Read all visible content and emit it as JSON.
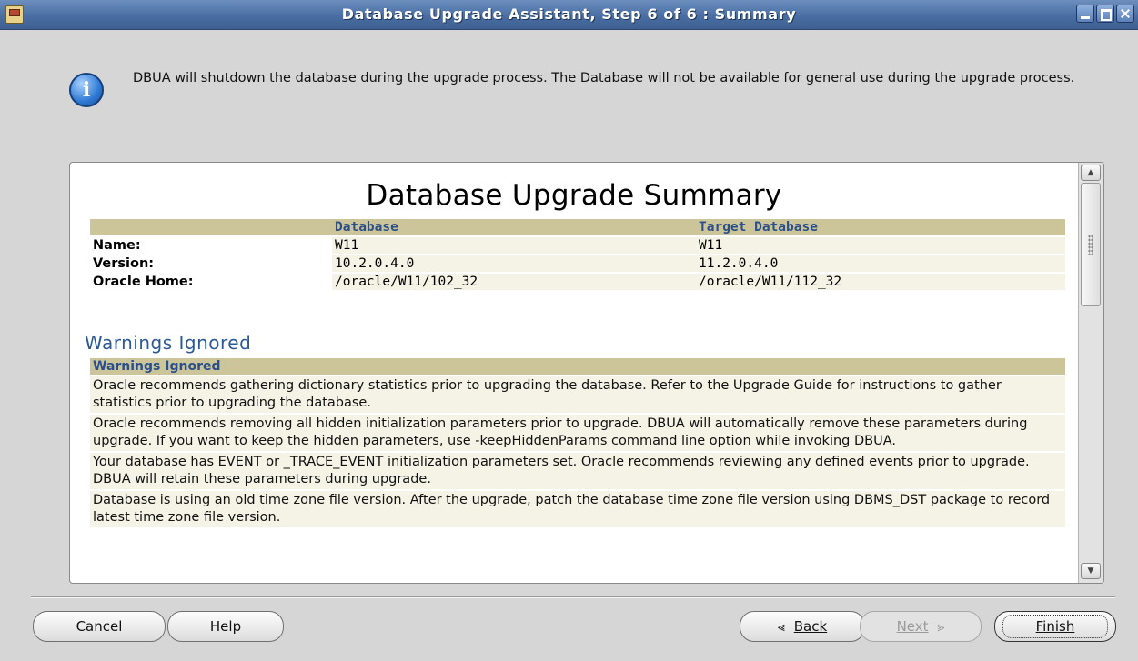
{
  "window": {
    "title": "Database Upgrade Assistant, Step 6 of 6 : Summary"
  },
  "info": {
    "icon": "info-icon",
    "message": "DBUA will shutdown the database during the upgrade process. The Database will not be available for general use during the upgrade process."
  },
  "summary": {
    "heading": "Database Upgrade Summary",
    "columns": [
      "",
      "Database",
      "Target Database"
    ],
    "rows": [
      {
        "label": "Name:",
        "source": "W11",
        "target": "W11"
      },
      {
        "label": "Version:",
        "source": "10.2.0.4.0",
        "target": "11.2.0.4.0"
      },
      {
        "label": "Oracle Home:",
        "source": "/oracle/W11/102_32",
        "target": "/oracle/W11/112_32"
      }
    ]
  },
  "warnings": {
    "heading": "Warnings Ignored",
    "table_header": "Warnings Ignored",
    "items": [
      "Oracle recommends gathering dictionary statistics prior to upgrading the database. Refer to the Upgrade Guide for instructions to gather statistics prior to upgrading the database.",
      "Oracle recommends removing all hidden initialization parameters prior to upgrade. DBUA will automatically remove these parameters during upgrade. If you want to keep the hidden parameters, use -keepHiddenParams command line option while invoking DBUA.",
      "Your database has EVENT or _TRACE_EVENT initialization parameters set. Oracle recommends reviewing any defined events prior to upgrade. DBUA will retain these parameters during upgrade.",
      "Database is using an old time zone file version. After the upgrade, patch the database time zone file version using DBMS_DST package to record latest time zone file version."
    ]
  },
  "buttons": {
    "cancel": "Cancel",
    "help": "Help",
    "back": "Back",
    "next": "Next",
    "finish": "Finish"
  }
}
